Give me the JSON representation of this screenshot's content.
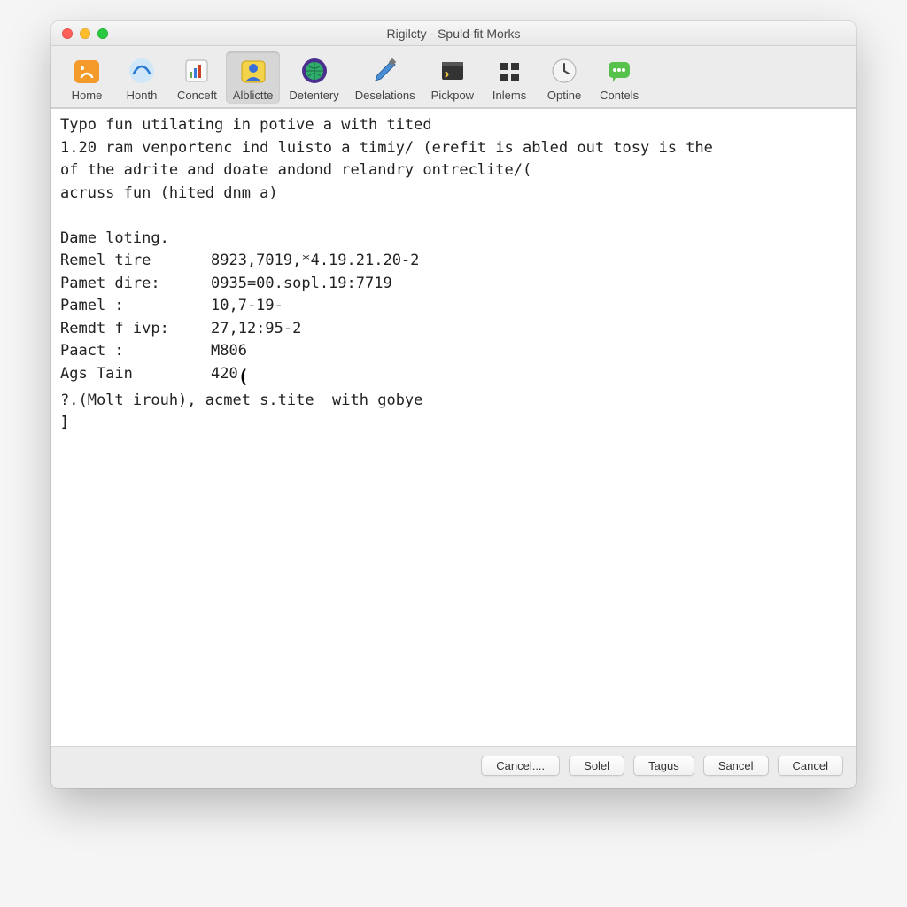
{
  "window": {
    "title": "Rigilcty - Spuld-fit Morks"
  },
  "toolbar": {
    "items": [
      {
        "label": "Home",
        "icon": "home-s-icon"
      },
      {
        "label": "Honth",
        "icon": "wave-icon"
      },
      {
        "label": "Conceft",
        "icon": "chart-icon"
      },
      {
        "label": "Alblictte",
        "icon": "person-icon",
        "selected": true
      },
      {
        "label": "Detentery",
        "icon": "globe-icon"
      },
      {
        "label": "Deselations",
        "icon": "pen-icon"
      },
      {
        "label": "Pickpow",
        "icon": "terminal-icon"
      },
      {
        "label": "Inlems",
        "icon": "grid-icon"
      },
      {
        "label": "Optine",
        "icon": "clock-icon"
      },
      {
        "label": "Contels",
        "icon": "chat-icon"
      }
    ]
  },
  "content": {
    "line1": "Typo fun utilating in potive a with tited",
    "line2": "1.20 ram venportenc ind luisto a timiy/ (erefit is abled out tosy is the",
    "line3": "of the adrite and doate andond relandry ontreclite/(",
    "line4": "acruss fun (hited dnm a)",
    "blank1": "",
    "line5": "Dame loting.",
    "rows": [
      {
        "label": "Remel tire",
        "value": "8923,7019,*4.19.21.20-2"
      },
      {
        "label": "Pamet dire:",
        "value": "0935=00.sopl.19:7719"
      },
      {
        "label": "Pamel :",
        "value": "10,7-19-"
      },
      {
        "label": "Remdt f ivp:",
        "value": "27,12:95-2"
      },
      {
        "label": "Paact :",
        "value": "M806"
      },
      {
        "label": "Ags Tain",
        "value": "420"
      }
    ],
    "line6": "?.(Molt irouh), acmet s.tite  with gobye",
    "prompt": "]"
  },
  "buttons": {
    "b1": "Cancel....",
    "b2": "Solel",
    "b3": "Tagus",
    "b4": "Sancel",
    "b5": "Cancel"
  }
}
